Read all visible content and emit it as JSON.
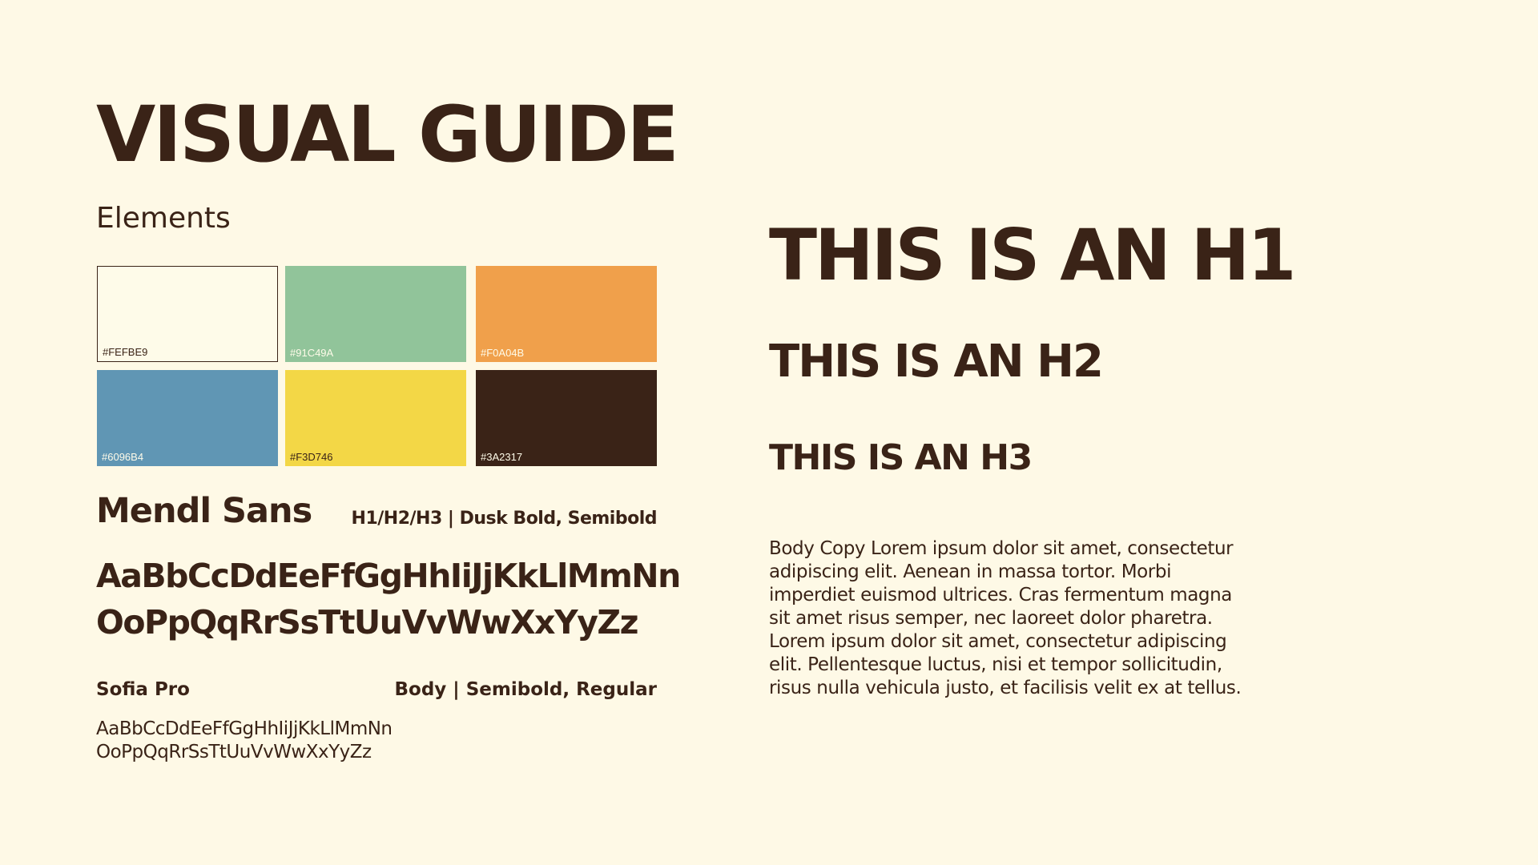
{
  "title": "VISUAL GUIDE",
  "elements_label": "Elements",
  "swatches": [
    {
      "hex": "#FEFBE9",
      "label_color": "#3A2317"
    },
    {
      "hex": "#91C49A",
      "label_color": "#FEFBE9"
    },
    {
      "hex": "#F0A04B",
      "label_color": "#FEFBE9"
    },
    {
      "hex": "#6096B4",
      "label_color": "#FEFBE9"
    },
    {
      "hex": "#F3D746",
      "label_color": "#3A2317"
    },
    {
      "hex": "#3A2317",
      "label_color": "#FEFBE9"
    }
  ],
  "fonts": {
    "heading": {
      "name": "Mendl Sans",
      "usage": "H1/H2/H3 | Dusk Bold, Semibold",
      "sample_line1": "AaBbCcDdEeFfGgHhIiJjKkLlMmNn",
      "sample_line2": "OoPpQqRrSsTtUuVvWwXxYyZz"
    },
    "body": {
      "name": "Sofia Pro",
      "usage": "Body | Semibold, Regular",
      "sample_line1": "AaBbCcDdEeFfGgHhIiJjKkLlMmNn",
      "sample_line2": "OoPpQqRrSsTtUuVvWwXxYyZz"
    }
  },
  "headings": {
    "h1": "THIS IS AN H1",
    "h2": "THIS IS AN H2",
    "h3": "THIS IS AN H3"
  },
  "body_copy": [
    "Body Copy Lorem ipsum dolor sit amet, consectetur",
    "adipiscing elit. Aenean in massa  tortor. Morbi",
    "imperdiet euismod ultrices. Cras fermentum magna",
    "sit amet  risus semper, nec laoreet dolor pharetra.",
    "Lorem ipsum dolor sit amet,  consectetur adipiscing",
    "elit. Pellentesque luctus, nisi et tempor  sollicitudin,",
    "risus nulla vehicula justo, et facilisis velit ex at  tellus."
  ]
}
